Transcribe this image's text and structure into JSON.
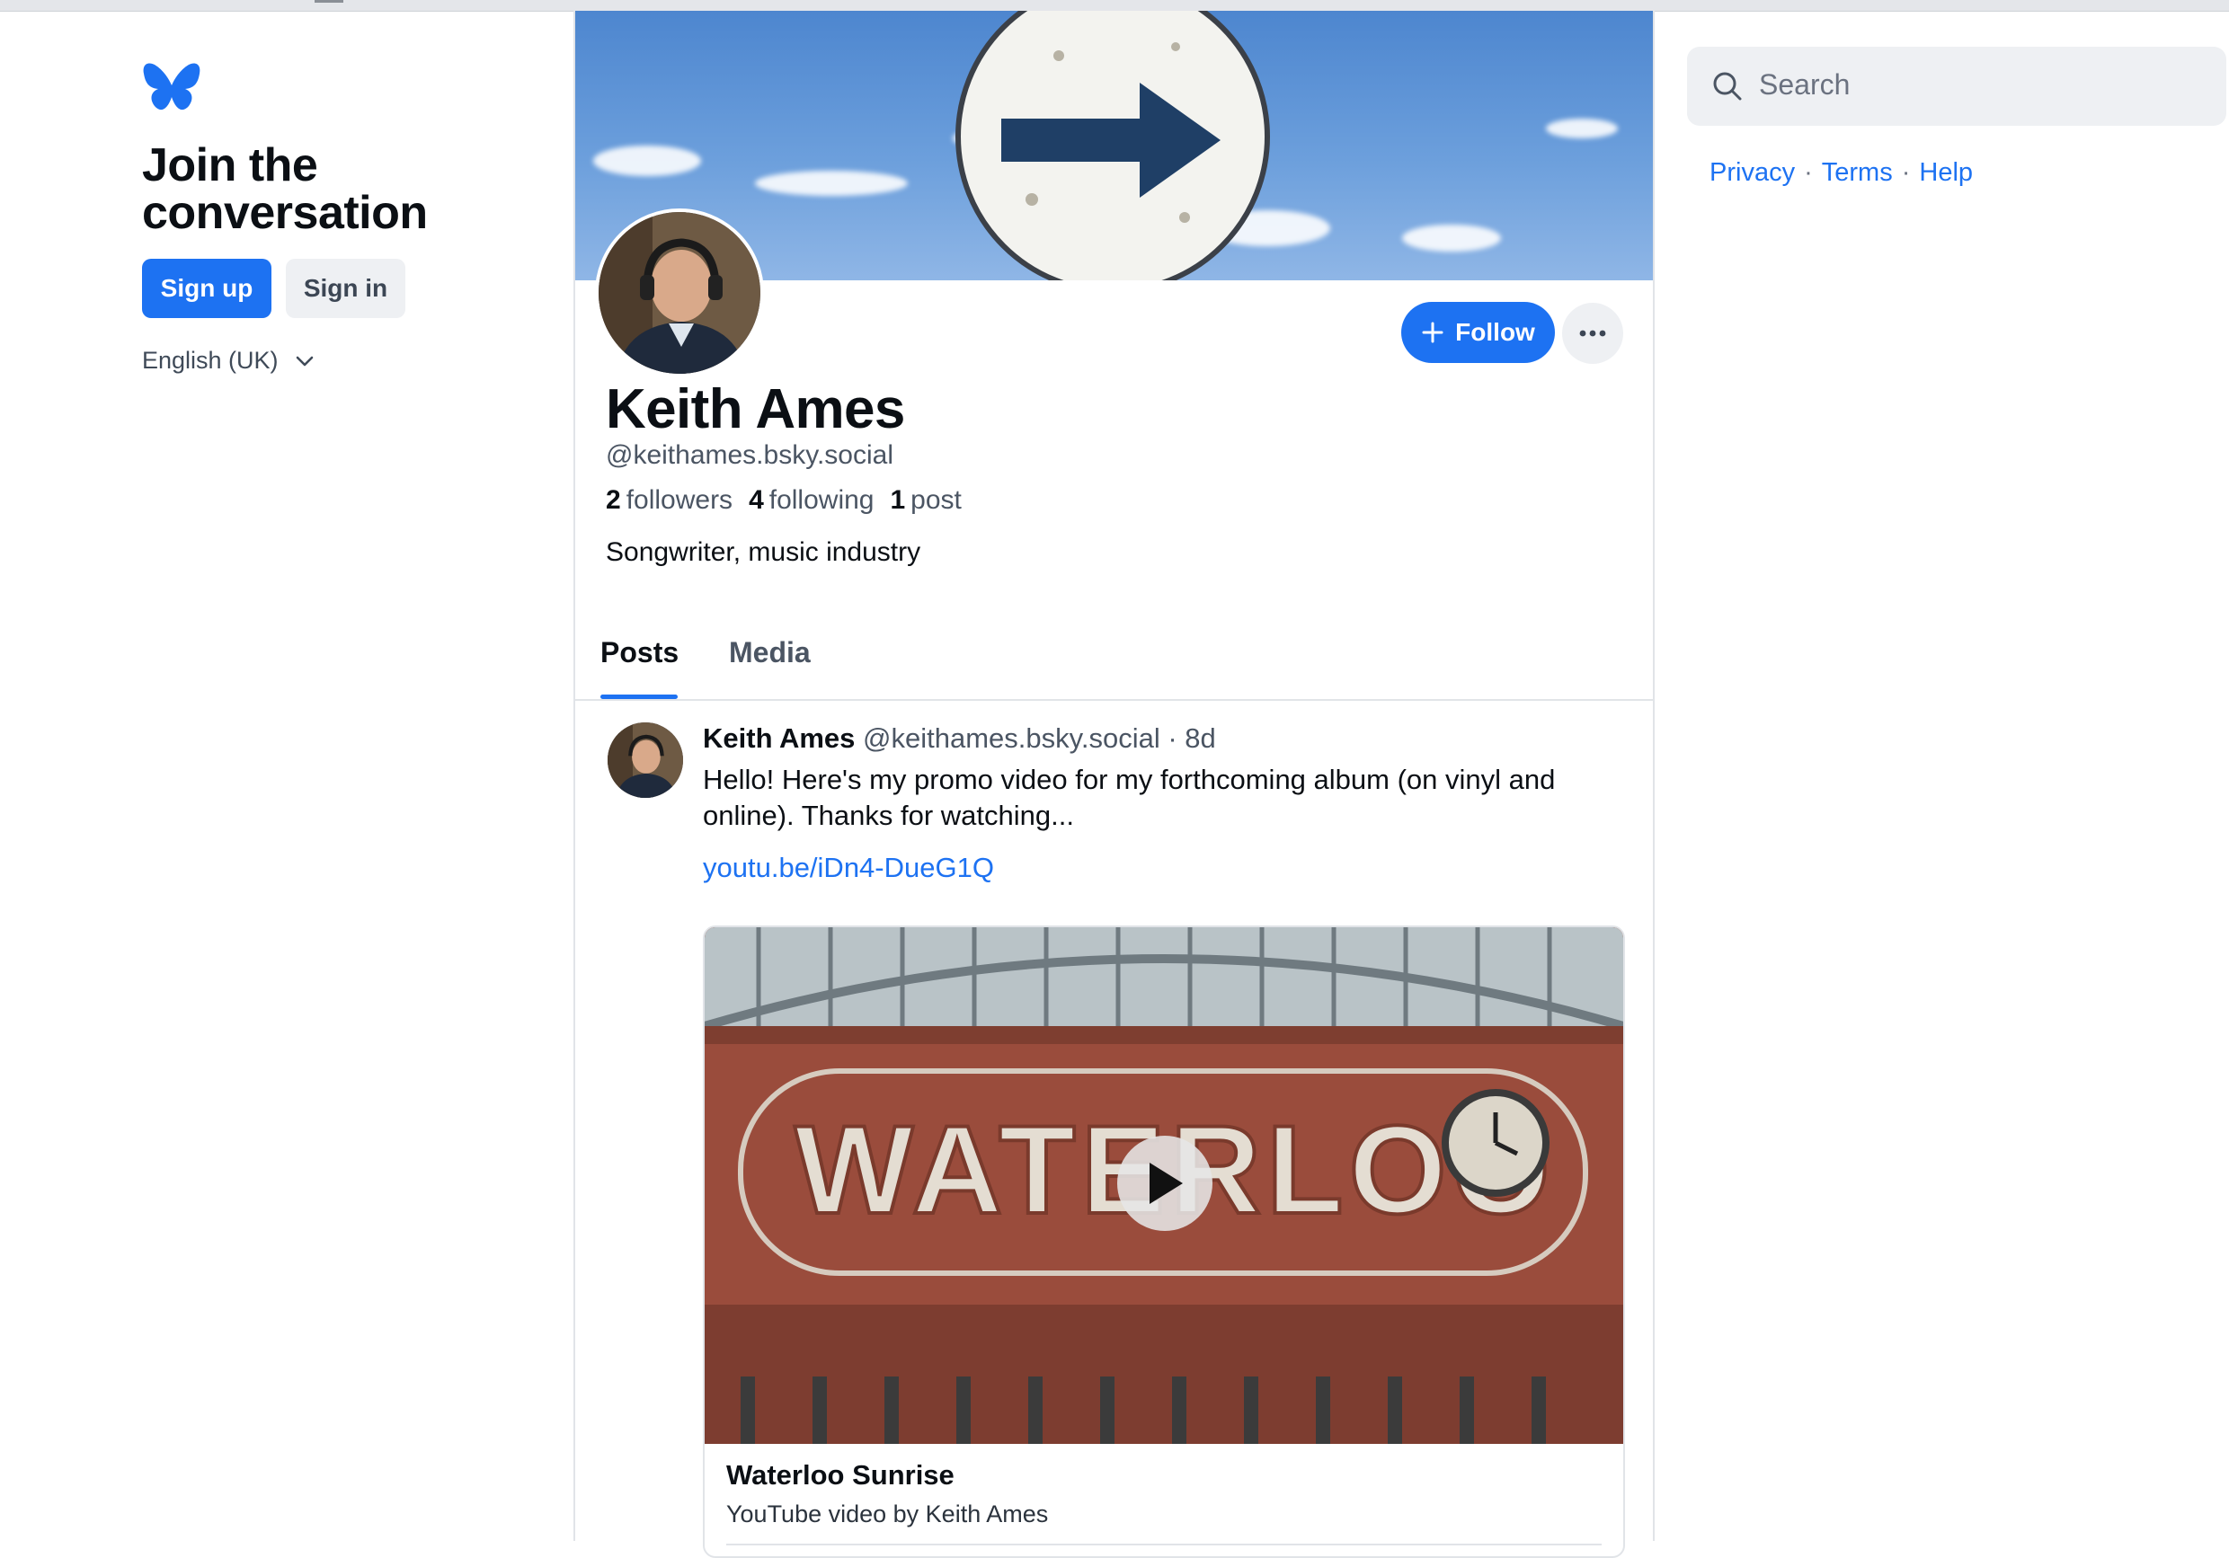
{
  "sidebar": {
    "logo_icon": "butterfly-icon",
    "title": "Join the conversation",
    "signup_label": "Sign up",
    "signin_label": "Sign in",
    "language": "English (UK)"
  },
  "profile": {
    "name": "Keith Ames",
    "handle": "@keithames.bsky.social",
    "followers_count": "2",
    "followers_label": "followers",
    "following_count": "4",
    "following_label": "following",
    "posts_count": "1",
    "posts_label": "post",
    "bio": "Songwriter, music industry",
    "follow_label": "Follow",
    "more_icon": "more-horizontal-icon"
  },
  "tabs": [
    {
      "label": "Posts",
      "active": true
    },
    {
      "label": "Media",
      "active": false
    }
  ],
  "post": {
    "author": "Keith Ames",
    "handle": "@keithames.bsky.social",
    "time": "· 8d",
    "text": "Hello! Here's my promo video for my forthcoming album (on vinyl and online). Thanks for watching...",
    "link": "youtu.be/iDn4-DueG1Q",
    "embed": {
      "image_text": "WATERLOO",
      "title": "Waterloo Sunrise",
      "description": "YouTube video by Keith Ames"
    }
  },
  "search": {
    "placeholder": "Search"
  },
  "footer_links": [
    "Privacy",
    "Terms",
    "Help"
  ],
  "colors": {
    "accent": "#1d72f2",
    "text": "#0b0f14",
    "muted": "#4b5563",
    "border": "#e1e4e8"
  }
}
